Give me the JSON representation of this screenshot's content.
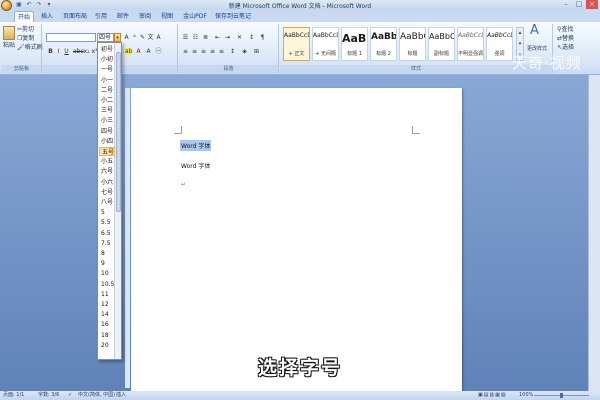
{
  "window": {
    "title": "新建 Microsoft Office Word 文档 - Microsoft Word"
  },
  "quick_access": {
    "save_icon": "save-icon",
    "undo_icon": "undo-icon",
    "redo_icon": "redo-icon"
  },
  "tabs": [
    "开始",
    "插入",
    "页面布局",
    "引用",
    "邮件",
    "审阅",
    "视图",
    "金山PDF",
    "保存到云笔记"
  ],
  "ribbon": {
    "clipboard": {
      "paste": "粘贴",
      "cut": "剪切",
      "copy": "复制",
      "format_painter": "格式刷",
      "label": "剪贴板"
    },
    "font": {
      "size_value": "四号",
      "label": "字体"
    },
    "paragraph": {
      "label": "段落"
    },
    "styles": {
      "items": [
        {
          "sample": "AaBbCcDd",
          "name": "+ 正文"
        },
        {
          "sample": "AaBbCcDd",
          "name": "+ 无间隔"
        },
        {
          "sample": "AaBb",
          "name": "标题 1"
        },
        {
          "sample": "AaBbC",
          "name": "标题 2"
        },
        {
          "sample": "AaBbC",
          "name": "标题"
        },
        {
          "sample": "AaBbC",
          "name": "副标题"
        },
        {
          "sample": "AaBbCcDd",
          "name": "不明显强调"
        },
        {
          "sample": "AaBbCcDd",
          "name": "强调"
        }
      ],
      "change_styles": "更改样式",
      "label": "样式"
    },
    "editing": {
      "find": "查找",
      "replace": "替换",
      "select": "选择"
    }
  },
  "font_size_dropdown": {
    "options": [
      "初号",
      "小初",
      "一号",
      "小一",
      "二号",
      "小二",
      "三号",
      "小三",
      "四号",
      "小四",
      "五号",
      "小五",
      "六号",
      "小六",
      "七号",
      "八号",
      "5",
      "5.5",
      "6.5",
      "7.5",
      "8",
      "9",
      "10",
      "10.5",
      "11",
      "12",
      "14",
      "16",
      "18",
      "20"
    ],
    "highlighted": "五号"
  },
  "document": {
    "line1": "Word 字体",
    "line2": "Word 字体",
    "paragraph_mark": "↵"
  },
  "caption": "选择字号",
  "watermark": "天奇·视频",
  "status": {
    "page": "页面: 1/1",
    "words": "字数: 3/6",
    "language": "中文(简体, 中国)",
    "mode": "插入",
    "zoom": "100%"
  }
}
